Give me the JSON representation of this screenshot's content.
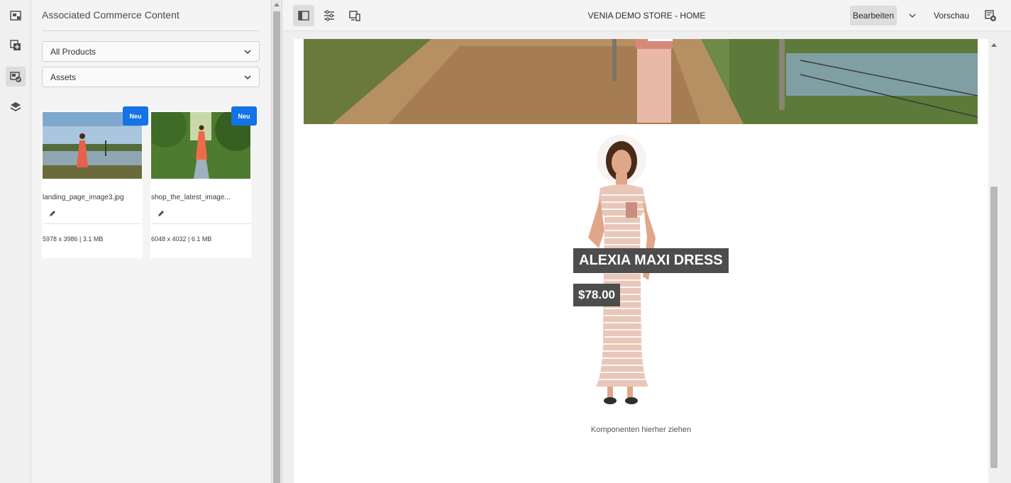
{
  "rail": {
    "items": [
      {
        "name": "page-info-icon",
        "active": false
      },
      {
        "name": "components-icon",
        "active": false
      },
      {
        "name": "assets-icon",
        "active": true
      },
      {
        "name": "layers-icon",
        "active": false
      }
    ]
  },
  "panel": {
    "title": "Associated Commerce Content",
    "filter_products": "All Products",
    "filter_type": "Assets",
    "assets": [
      {
        "badge": "Neu",
        "filename": "landing_page_image3.jpg",
        "meta": "5978 x 3986 | 3.1 MB"
      },
      {
        "badge": "Neu",
        "filename": "shop_the_latest_image...",
        "meta": "6048 x 4032 | 6.1 MB"
      }
    ]
  },
  "toolbar": {
    "page_title": "VENIA DEMO STORE - HOME",
    "edit_label": "Bearbeiten",
    "preview_label": "Vorschau"
  },
  "content": {
    "product_name": "ALEXIA MAXI DRESS",
    "product_price": "$78.00",
    "drop_hint": "Komponenten hierher ziehen"
  },
  "colors": {
    "accent": "#1473e6",
    "label_bg": "#4d4d4d"
  }
}
